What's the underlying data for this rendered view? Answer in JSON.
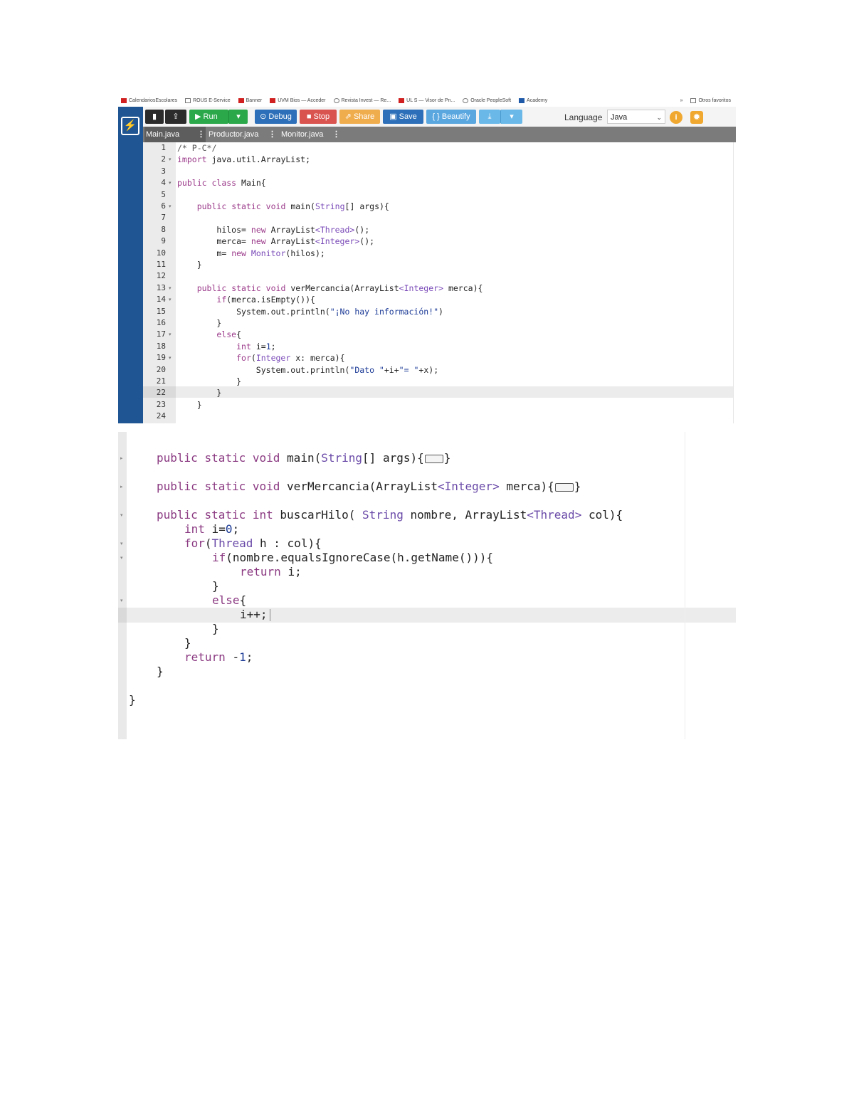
{
  "bookmarks": [
    {
      "label": "CalendariosEscolares",
      "icon": "red-logo-icon"
    },
    {
      "label": "ROUS E-Service",
      "icon": "page-icon"
    },
    {
      "label": "Banner",
      "icon": "red-logo-icon"
    },
    {
      "label": "UVM Bios — Acceder",
      "icon": "red-logo-icon"
    },
    {
      "label": "Revista Invest — Re...",
      "icon": "globe-icon"
    },
    {
      "label": "UL S — Visor de Pn...",
      "icon": "red-square-icon"
    },
    {
      "label": "Oracle PeopleSoft",
      "icon": "globe-icon"
    },
    {
      "label": "Academy",
      "icon": "blue-square-icon"
    }
  ],
  "bookmarks_more": "»",
  "bookmarks_other": "Otros favoritos",
  "toolbar": {
    "logo_glyph": "⚡",
    "new_file_glyph": "▮",
    "upload_glyph": "⇪",
    "run_label": "▶ Run",
    "run_menu_glyph": "▾",
    "debug_label": "⊙ Debug",
    "stop_label": "■ Stop",
    "share_label": "⇗ Share",
    "save_label": "▣ Save",
    "beautify_label": "{ } Beautify",
    "download_glyph": "⤓",
    "download_menu_glyph": "▾",
    "language_label": "Language",
    "language_value": "Java",
    "language_chevron": "⌄",
    "info_glyph": "i",
    "settings_glyph": "✹"
  },
  "tabs": [
    {
      "label": "Main.java",
      "dots": "⋮",
      "active": true
    },
    {
      "label": "Productor.java",
      "dots": "⋮",
      "active": false
    },
    {
      "label": "Monitor.java",
      "dots": "⋮",
      "active": false
    }
  ],
  "editor1": {
    "fold_glyph": "▾",
    "lines": [
      {
        "n": "1",
        "text": "/* P-C*/"
      },
      {
        "n": "2",
        "text": "import java.util.ArrayList;",
        "fold": true
      },
      {
        "n": "3",
        "text": ""
      },
      {
        "n": "4",
        "text": "public class Main{",
        "fold": true
      },
      {
        "n": "5",
        "text": ""
      },
      {
        "n": "6",
        "text": "    public static void main(String[] args){",
        "fold": true
      },
      {
        "n": "7",
        "text": ""
      },
      {
        "n": "8",
        "text": "        hilos= new ArrayList<Thread>();"
      },
      {
        "n": "9",
        "text": "        merca= new ArrayList<Integer>();"
      },
      {
        "n": "10",
        "text": "        m= new Monitor(hilos);"
      },
      {
        "n": "11",
        "text": "    }"
      },
      {
        "n": "12",
        "text": ""
      },
      {
        "n": "13",
        "text": "    public static void verMercancia(ArrayList<Integer> merca){",
        "fold": true
      },
      {
        "n": "14",
        "text": "        if(merca.isEmpty()){",
        "fold": true
      },
      {
        "n": "15",
        "text": "            System.out.println(\"¡No hay información!\")"
      },
      {
        "n": "16",
        "text": "        }"
      },
      {
        "n": "17",
        "text": "        else{",
        "fold": true
      },
      {
        "n": "18",
        "text": "            int i=1;"
      },
      {
        "n": "19",
        "text": "            for(Integer x: merca){",
        "fold": true
      },
      {
        "n": "20",
        "text": "                System.out.println(\"Dato \"+i+\"= \"+x);"
      },
      {
        "n": "21",
        "text": "            }"
      },
      {
        "n": "22",
        "text": "        }"
      },
      {
        "n": "23",
        "text": "    }"
      },
      {
        "n": "24",
        "text": ""
      }
    ]
  },
  "editor2": {
    "fold_glyph": "▸",
    "fold_open_glyph": "▾",
    "lines": [
      "public static void main(String[] args){",
      "public static void verMercancia(ArrayList<Integer> merca){",
      "public static int buscarHilo( String nombre, ArrayList<Thread> col){",
      "int i=0;",
      "for(Thread h : col){",
      "if(nombre.equalsIgnoreCase(h.getName())){",
      "return i;",
      "}",
      "else{",
      "i++;",
      "}",
      "}",
      "return -1;",
      "}",
      "}"
    ]
  }
}
